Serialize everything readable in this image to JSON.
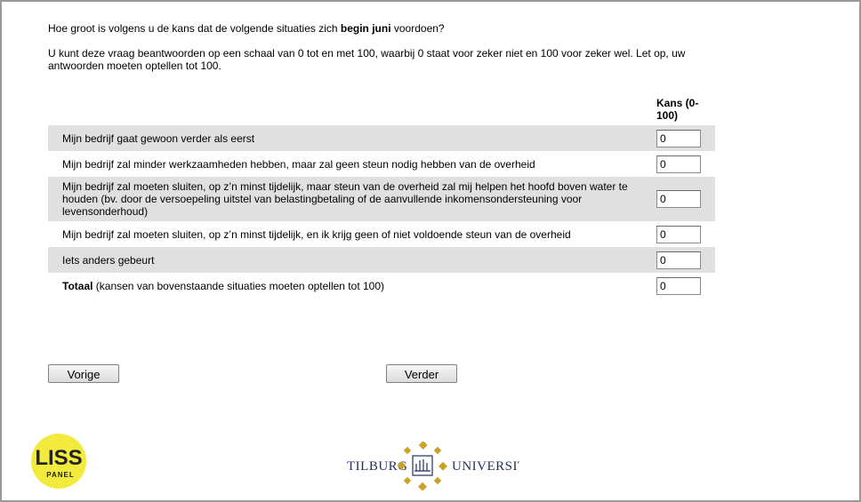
{
  "question": {
    "prefix": "Hoe groot is volgens u de kans dat de volgende situaties zich ",
    "emphasis": "begin juni",
    "suffix": " voordoen?"
  },
  "instruction": "U kunt deze vraag beantwoorden op een schaal van 0 tot en met 100, waarbij 0 staat voor zeker niet en 100 voor zeker wel. Let op, uw antwoorden moeten optellen tot 100.",
  "column_header": "Kans (0-100)",
  "rows": [
    {
      "label": "Mijn bedrijf gaat gewoon verder als eerst",
      "value": "0"
    },
    {
      "label": "Mijn bedrijf zal minder werkzaamheden hebben, maar zal geen steun nodig hebben van de overheid",
      "value": "0"
    },
    {
      "label": "Mijn bedrijf zal moeten sluiten, op z’n minst tijdelijk, maar steun van de overheid zal mij helpen het hoofd boven water te houden (bv. door de versoepeling uitstel van belastingbetaling of de aanvullende inkomensondersteuning voor levensonderhoud)",
      "value": "0"
    },
    {
      "label": "Mijn bedrijf zal moeten sluiten, op z’n minst tijdelijk, en ik krijg geen of niet voldoende steun van de overheid",
      "value": "0"
    },
    {
      "label": "Iets anders gebeurt",
      "value": "0"
    }
  ],
  "total": {
    "label_bold": "Totaal",
    "label_rest": " (kansen van bovenstaande situaties moeten optellen tot 100)",
    "value": "0"
  },
  "buttons": {
    "previous": "Vorige",
    "next": "Verder"
  },
  "logos": {
    "liss_top": "LISS",
    "liss_bottom": "PANEL",
    "tilburg_left": "TILBURG",
    "tilburg_right": "UNIVERSITY"
  },
  "colors": {
    "shaded_row": "#e0e0e0",
    "liss_yellow": "#f2ea3c",
    "tilburg_gold": "#c9a227",
    "tilburg_navy": "#1f2f5f"
  }
}
